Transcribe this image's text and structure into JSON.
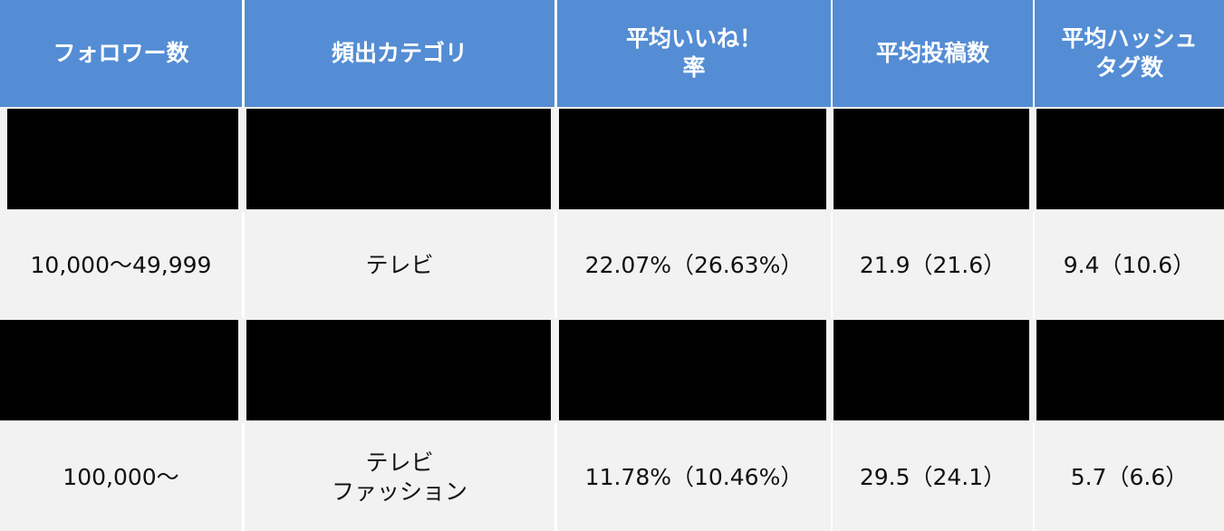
{
  "headers": [
    {
      "lines": [
        "フォロワー数"
      ]
    },
    {
      "lines": [
        "頻出カテゴリ"
      ]
    },
    {
      "lines": [
        "平均いいね！",
        "率"
      ]
    },
    {
      "lines": [
        "平均投稿数"
      ]
    },
    {
      "lines": [
        "平均ハッシュ",
        "タグ数"
      ]
    }
  ],
  "rows": [
    {
      "redacted": true
    },
    {
      "cells": [
        {
          "lines": [
            "10,000〜49,999"
          ]
        },
        {
          "lines": [
            "テレビ"
          ]
        },
        {
          "lines": [
            "22.07%（26.63%）"
          ]
        },
        {
          "lines": [
            "21.9（21.6）"
          ]
        },
        {
          "lines": [
            "9.4（10.6）"
          ]
        }
      ]
    },
    {
      "redacted": true
    },
    {
      "cells": [
        {
          "lines": [
            "100,000〜"
          ]
        },
        {
          "lines": [
            "テレビ",
            "ファッション"
          ]
        },
        {
          "lines": [
            "11.78%（10.46%）"
          ]
        },
        {
          "lines": [
            "29.5（24.1）"
          ]
        },
        {
          "lines": [
            "5.7（6.6）"
          ]
        }
      ]
    }
  ],
  "colors": {
    "header_bg": "#548dd4",
    "header_text": "#ffffff",
    "row_bg": "#f2f2f2",
    "redaction": "#000000"
  }
}
